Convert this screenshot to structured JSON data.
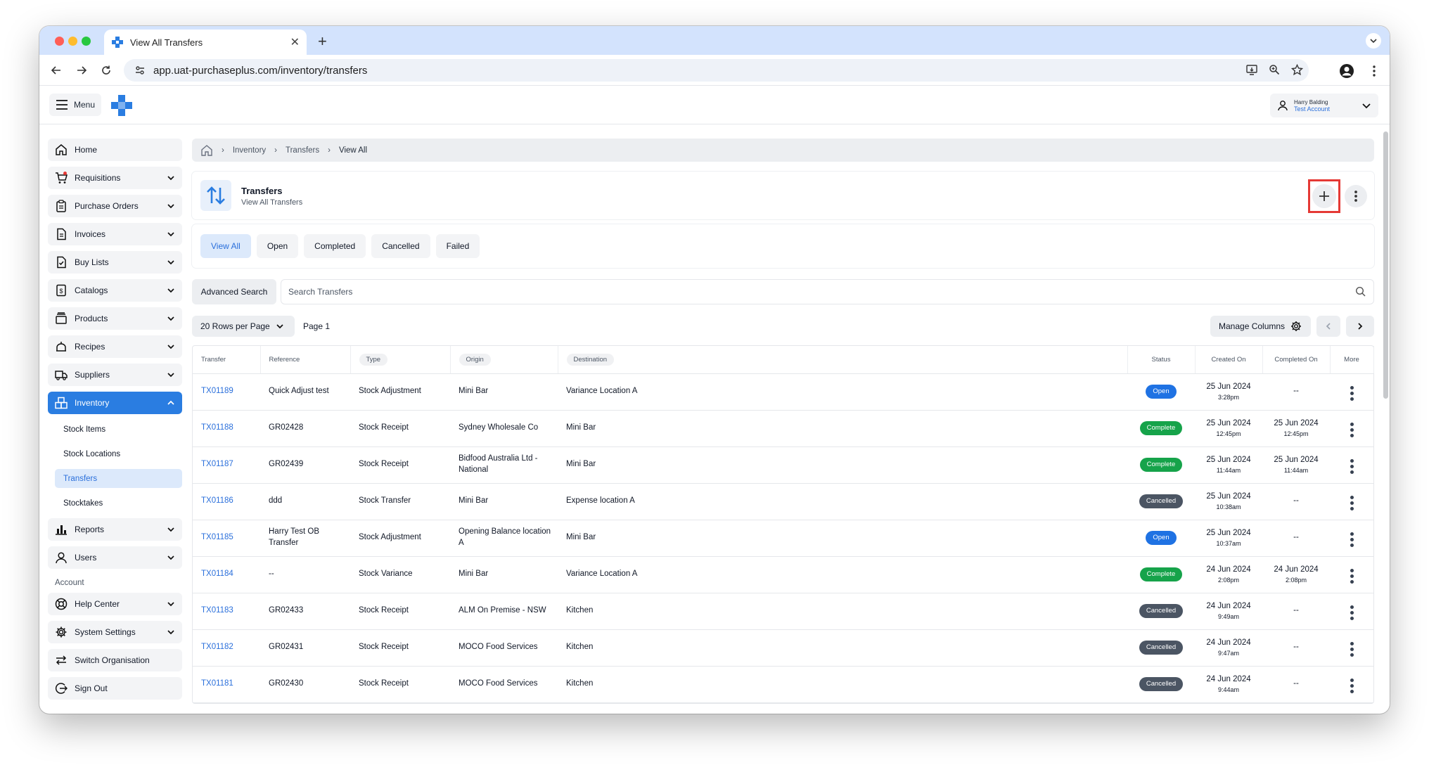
{
  "browser": {
    "tab_title": "View All Transfers",
    "url": "app.uat-purchaseplus.com/inventory/transfers"
  },
  "header": {
    "menu_label": "Menu",
    "user_name": "Harry Balding",
    "account": "Test Account"
  },
  "sidebar": {
    "items": [
      {
        "label": "Home",
        "icon": "home-icon"
      },
      {
        "label": "Requisitions",
        "icon": "cart-icon"
      },
      {
        "label": "Purchase Orders",
        "icon": "clipboard-icon"
      },
      {
        "label": "Invoices",
        "icon": "document-icon"
      },
      {
        "label": "Buy Lists",
        "icon": "checklist-icon"
      },
      {
        "label": "Catalogs",
        "icon": "catalog-icon"
      },
      {
        "label": "Products",
        "icon": "box-icon"
      },
      {
        "label": "Recipes",
        "icon": "recipe-icon"
      },
      {
        "label": "Suppliers",
        "icon": "truck-icon"
      },
      {
        "label": "Inventory",
        "icon": "inventory-icon"
      }
    ],
    "inventory_sub": [
      "Stock Items",
      "Stock Locations",
      "Transfers",
      "Stocktakes"
    ],
    "items_after": [
      {
        "label": "Reports",
        "icon": "chart-icon"
      },
      {
        "label": "Users",
        "icon": "user-icon"
      }
    ],
    "account_section": "Account",
    "account_items": [
      {
        "label": "Help Center",
        "icon": "lifebuoy-icon"
      },
      {
        "label": "System Settings",
        "icon": "gear-icon"
      },
      {
        "label": "Switch Organisation",
        "icon": "switch-icon"
      },
      {
        "label": "Sign Out",
        "icon": "sign-out-icon"
      }
    ]
  },
  "breadcrumb": [
    "Inventory",
    "Transfers",
    "View All"
  ],
  "page": {
    "title": "Transfers",
    "subtitle": "View All Transfers"
  },
  "filters": [
    "View All",
    "Open",
    "Completed",
    "Cancelled",
    "Failed"
  ],
  "search": {
    "advanced_label": "Advanced Search",
    "placeholder": "Search Transfers"
  },
  "pager": {
    "rows_label": "20 Rows per Page",
    "page_label": "Page 1",
    "manage_columns": "Manage Columns"
  },
  "table": {
    "headers": {
      "transfer": "Transfer",
      "reference": "Reference",
      "type": "Type",
      "origin": "Origin",
      "destination": "Destination",
      "status": "Status",
      "created": "Created On",
      "completed": "Completed On",
      "more": "More"
    },
    "rows": [
      {
        "transfer": "TX01189",
        "reference": "Quick Adjust test",
        "type": "Stock Adjustment",
        "origin": "Mini Bar",
        "destination": "Variance Location A",
        "status": "Open",
        "created_date": "25 Jun 2024",
        "created_time": "3:28pm",
        "completed_date": "--",
        "completed_time": ""
      },
      {
        "transfer": "TX01188",
        "reference": "GR02428",
        "type": "Stock Receipt",
        "origin": "Sydney Wholesale Co",
        "destination": "Mini Bar",
        "status": "Complete",
        "created_date": "25 Jun 2024",
        "created_time": "12:45pm",
        "completed_date": "25 Jun 2024",
        "completed_time": "12:45pm"
      },
      {
        "transfer": "TX01187",
        "reference": "GR02439",
        "type": "Stock Receipt",
        "origin": "Bidfood Australia Ltd - National",
        "destination": "Mini Bar",
        "status": "Complete",
        "created_date": "25 Jun 2024",
        "created_time": "11:44am",
        "completed_date": "25 Jun 2024",
        "completed_time": "11:44am"
      },
      {
        "transfer": "TX01186",
        "reference": "ddd",
        "type": "Stock Transfer",
        "origin": "Mini Bar",
        "destination": "Expense location A",
        "status": "Cancelled",
        "created_date": "25 Jun 2024",
        "created_time": "10:38am",
        "completed_date": "--",
        "completed_time": ""
      },
      {
        "transfer": "TX01185",
        "reference": "Harry Test OB Transfer",
        "type": "Stock Adjustment",
        "origin": "Opening Balance location A",
        "destination": "Mini Bar",
        "status": "Open",
        "created_date": "25 Jun 2024",
        "created_time": "10:37am",
        "completed_date": "--",
        "completed_time": ""
      },
      {
        "transfer": "TX01184",
        "reference": "--",
        "type": "Stock Variance",
        "origin": "Mini Bar",
        "destination": "Variance Location A",
        "status": "Complete",
        "created_date": "24 Jun 2024",
        "created_time": "2:08pm",
        "completed_date": "24 Jun 2024",
        "completed_time": "2:08pm"
      },
      {
        "transfer": "TX01183",
        "reference": "GR02433",
        "type": "Stock Receipt",
        "origin": "ALM On Premise - NSW",
        "destination": "Kitchen",
        "status": "Cancelled",
        "created_date": "24 Jun 2024",
        "created_time": "9:49am",
        "completed_date": "--",
        "completed_time": ""
      },
      {
        "transfer": "TX01182",
        "reference": "GR02431",
        "type": "Stock Receipt",
        "origin": "MOCO Food Services",
        "destination": "Kitchen",
        "status": "Cancelled",
        "created_date": "24 Jun 2024",
        "created_time": "9:47am",
        "completed_date": "--",
        "completed_time": ""
      },
      {
        "transfer": "TX01181",
        "reference": "GR02430",
        "type": "Stock Receipt",
        "origin": "MOCO Food Services",
        "destination": "Kitchen",
        "status": "Cancelled",
        "created_date": "24 Jun 2024",
        "created_time": "9:44am",
        "completed_date": "--",
        "completed_time": ""
      }
    ]
  },
  "colors": {
    "accent": "#2a7de1",
    "link": "#2a6fdb",
    "status_open": "#1f72e3",
    "status_complete": "#16a34a",
    "status_cancelled": "#4b5563",
    "highlight": "#e53935"
  }
}
